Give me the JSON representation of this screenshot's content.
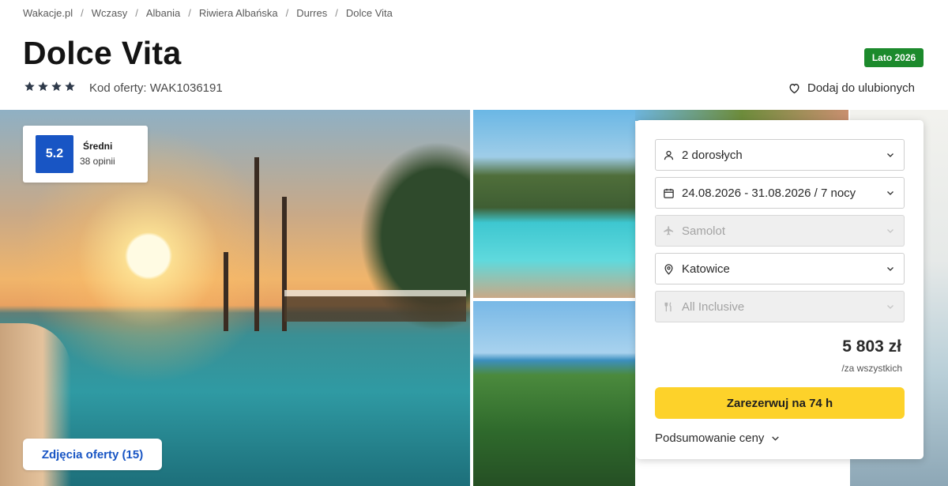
{
  "breadcrumb": [
    "Wakacje.pl",
    "Wczasy",
    "Albania",
    "Riwiera Albańska",
    "Durres",
    "Dolce Vita"
  ],
  "hotel": {
    "name": "Dolce Vita",
    "stars": 4,
    "offer_code": "Kod oferty: WAK1036191",
    "season_badge": "Lato 2026",
    "favorite_label": "Dodaj do ulubionych"
  },
  "rating": {
    "score": "5.2",
    "label": "Średni",
    "count": "38 opinii"
  },
  "gallery": {
    "photos_button": "Zdjęcia oferty (15)"
  },
  "booking": {
    "travellers": "2 dorosłych",
    "dates": "24.08.2026 - 31.08.2026 / 7 nocy",
    "transport": "Samolot",
    "departure": "Katowice",
    "board": "All Inclusive",
    "price": "5 803 zł",
    "price_note": "/za wszystkich",
    "reserve_button": "Zarezerwuj na 74 h",
    "summary_link": "Podsumowanie ceny"
  },
  "colors": {
    "brand_blue": "#1855c4",
    "badge_green": "#1c8a2c",
    "cta_yellow": "#fdd22a",
    "star": "#2f3a4a"
  },
  "icons": {
    "travellers": "person-icon",
    "dates": "calendar-icon",
    "transport": "plane-icon",
    "departure": "location-pin-icon",
    "board": "cutlery-icon",
    "favorite": "heart-icon"
  }
}
